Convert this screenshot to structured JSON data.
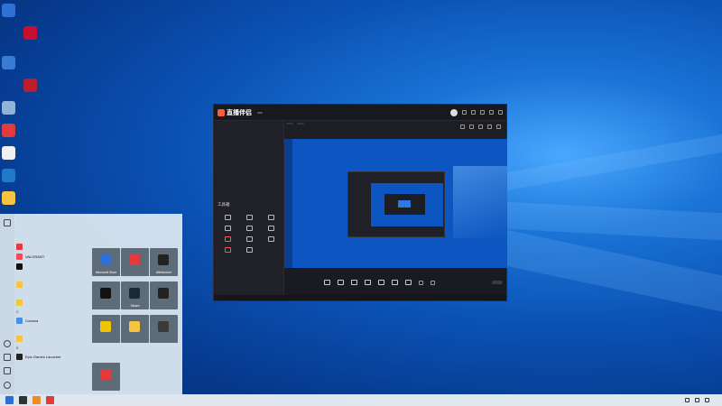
{
  "colors": {
    "accent": "#ff5a3c",
    "desktop_blue": "#0b52b5",
    "window_bg": "#1d1d24",
    "start_bg": "#d7e4ee"
  },
  "desktop_icons": [
    {
      "label": "",
      "color": "#2f6fd6",
      "icon": "app-icon"
    },
    {
      "label": "",
      "color": "#c8102e",
      "icon": "app-icon"
    },
    {
      "label": "",
      "color": "#3a7bd5",
      "icon": "network-icon"
    },
    {
      "label": "",
      "color": "#bb1e2e",
      "icon": "app-icon"
    },
    {
      "label": "",
      "color": "#8fb3d9",
      "icon": "recycle-bin-icon"
    },
    {
      "label": "",
      "color": "#e33b3b",
      "icon": "app-icon"
    },
    {
      "label": "",
      "color": "#f0f0f0",
      "icon": "file-icon"
    },
    {
      "label": "",
      "color": "#1f7ac7",
      "icon": "app-icon"
    },
    {
      "label": "",
      "color": "#f5c542",
      "icon": "folder-icon"
    },
    {
      "label": "",
      "color": "#7fb2e6",
      "icon": "app-icon"
    },
    {
      "label": "",
      "color": "#f2c400",
      "icon": "app-icon"
    }
  ],
  "app_window": {
    "brand": "直播伴侣",
    "version": "",
    "left_tabs": [
      "",
      "",
      ""
    ],
    "tools_title": "工具箱",
    "tools": [
      {
        "label": "",
        "hot": false
      },
      {
        "label": "",
        "hot": false
      },
      {
        "label": "",
        "hot": false
      },
      {
        "label": "",
        "hot": false
      },
      {
        "label": "",
        "hot": false
      },
      {
        "label": "",
        "hot": false
      },
      {
        "label": "",
        "hot": true
      },
      {
        "label": "",
        "hot": false
      },
      {
        "label": "",
        "hot": false
      },
      {
        "label": "",
        "hot": true
      },
      {
        "label": "",
        "hot": false
      }
    ],
    "bottom_tools": [
      {
        "label": ""
      },
      {
        "label": ""
      },
      {
        "label": ""
      },
      {
        "label": ""
      },
      {
        "label": ""
      },
      {
        "label": ""
      },
      {
        "label": ""
      }
    ],
    "go_live": ""
  },
  "start_menu": {
    "section_recent": "",
    "recent_apps": [
      {
        "label": "",
        "color": "#e33b3b"
      },
      {
        "label": "VALORANT",
        "color": "#ff4655"
      },
      {
        "label": "",
        "color": "#111111"
      }
    ],
    "groups": [
      {
        "letter": "",
        "apps": [
          {
            "label": "",
            "color": "#f5c542"
          }
        ]
      },
      {
        "letter": "",
        "apps": [
          {
            "label": "",
            "color": "#f5c542"
          }
        ]
      },
      {
        "letter": "C",
        "apps": [
          {
            "label": "Cortana",
            "color": "#4a90e2"
          }
        ]
      },
      {
        "letter": "",
        "apps": [
          {
            "label": "",
            "color": "#f5c542"
          }
        ]
      },
      {
        "letter": "E",
        "apps": [
          {
            "label": "Epic Games Launcher",
            "color": "#222222"
          }
        ]
      }
    ],
    "tile_group_letter": "",
    "tiles": [
      {
        "label": "Microsoft Store",
        "color": "#5e6b78",
        "icon_color": "#2f6fd6"
      },
      {
        "label": "",
        "color": "#5e6b78",
        "icon_color": "#e33b3b"
      },
      {
        "label": "Afterburner",
        "color": "#5e6b78",
        "icon_color": "#222"
      },
      {
        "label": "",
        "color": "#5e6b78",
        "icon_color": "#111"
      },
      {
        "label": "Steam",
        "color": "#5e6b78",
        "icon_color": "#1b2838"
      },
      {
        "label": "",
        "color": "#5e6b78",
        "icon_color": "#222"
      },
      {
        "label": "",
        "color": "#5e6b78",
        "icon_color": "#f2c400"
      },
      {
        "label": "",
        "color": "#5e6b78",
        "icon_color": "#f5c542"
      },
      {
        "label": "",
        "color": "#5e6b78",
        "icon_color": "#3a3a3a"
      },
      {
        "label": "",
        "color": "#5e6b78",
        "icon_color": "#e33b3b"
      }
    ]
  },
  "taskbar": {
    "apps": [
      {
        "icon": "start-icon",
        "color": "#2a6fd6"
      },
      {
        "icon": "search-icon",
        "color": "#333"
      },
      {
        "icon": "app-icon",
        "color": "#f08a24"
      },
      {
        "icon": "app-icon",
        "color": "#e33b3b"
      }
    ],
    "time": "",
    "date": ""
  }
}
